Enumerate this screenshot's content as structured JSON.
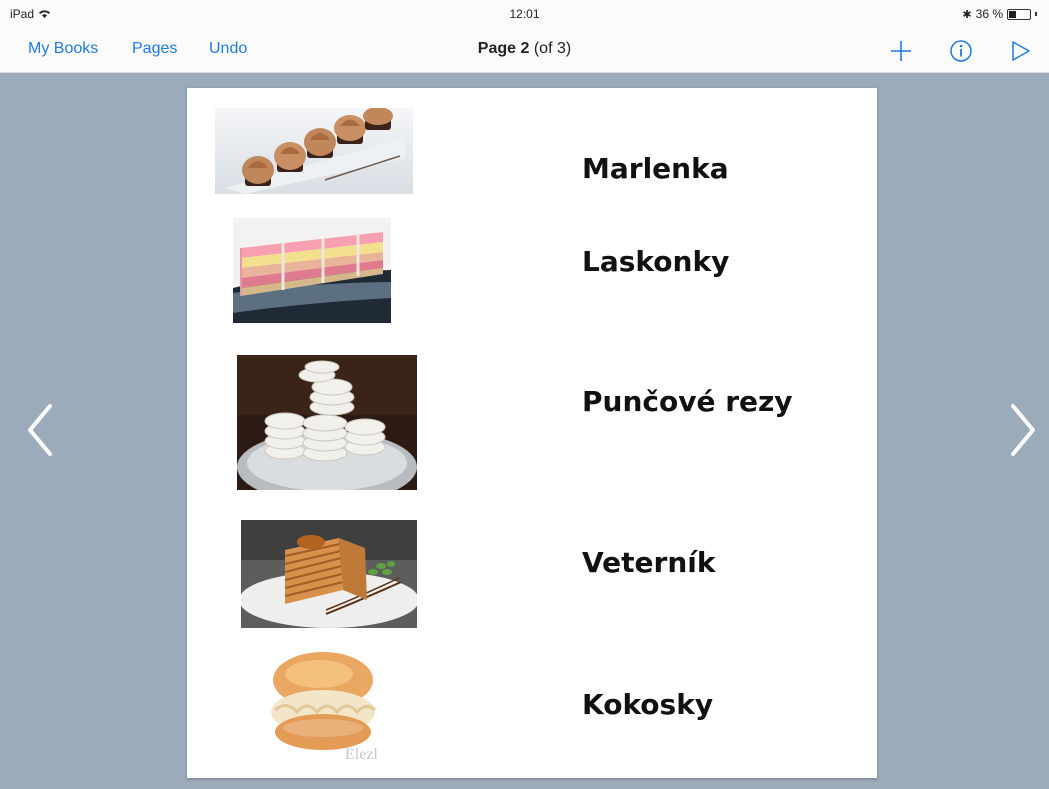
{
  "status": {
    "device": "iPad",
    "time": "12:01",
    "battery": "36 %",
    "battery_level": 0.36
  },
  "nav": {
    "my_books": "My Books",
    "pages": "Pages",
    "undo": "Undo",
    "title_bold": "Page 2",
    "title_rest": " (of 3)"
  },
  "items": [
    {
      "label": "Marlenka"
    },
    {
      "label": "Laskonky"
    },
    {
      "label": "Punčové rezy"
    },
    {
      "label": "Veterník"
    },
    {
      "label": "Kokosky",
      "watermark": "Elezl"
    }
  ],
  "colors": {
    "accent": "#1f7ae0",
    "background": "#9cabba"
  }
}
